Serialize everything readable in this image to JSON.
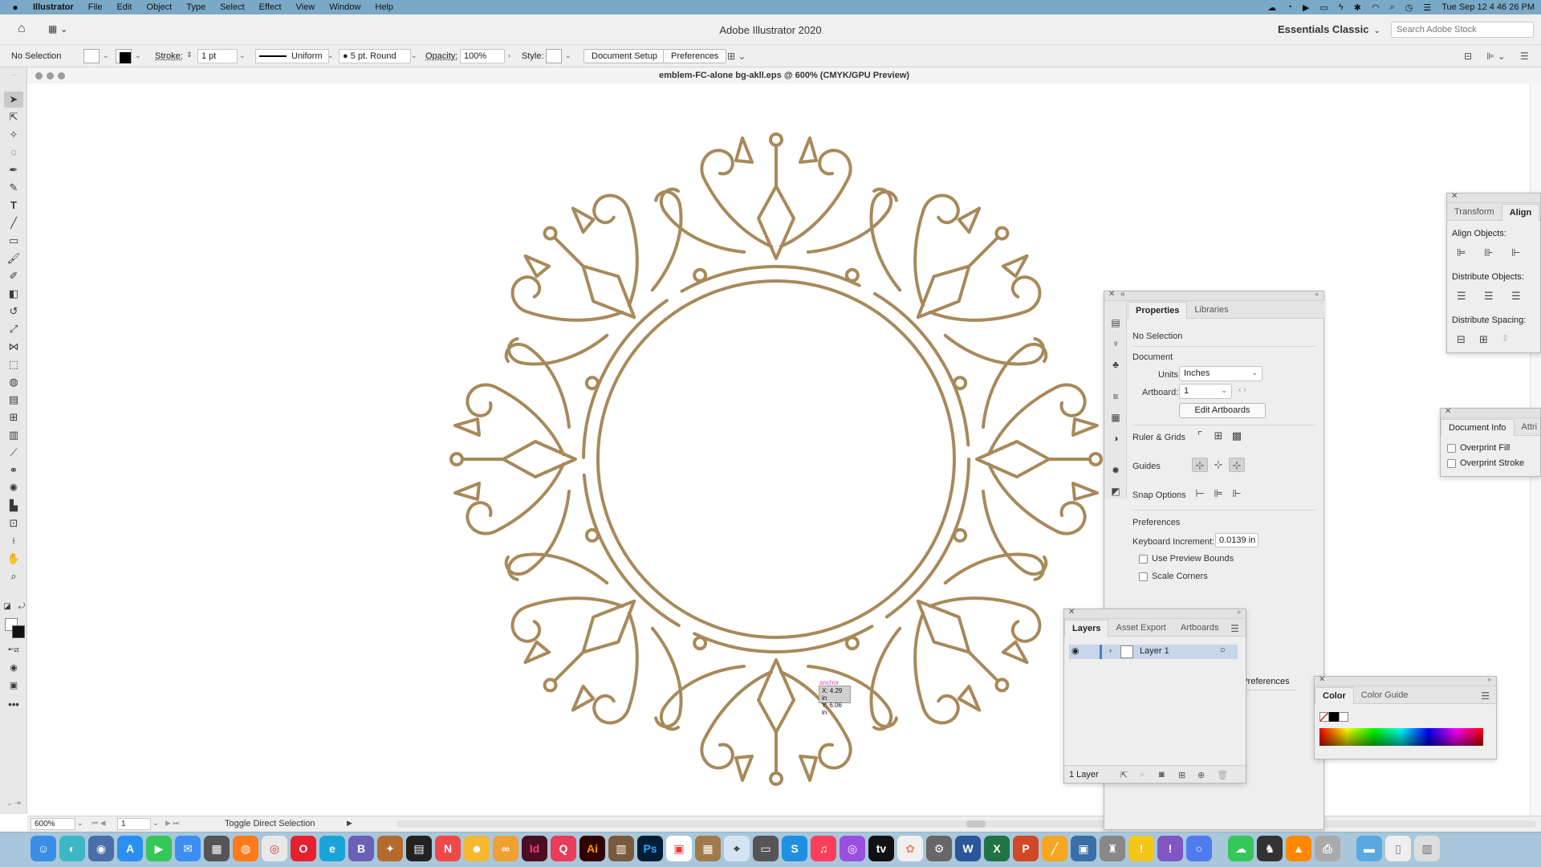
{
  "menubar": {
    "app": "Illustrator",
    "items": [
      "File",
      "Edit",
      "Object",
      "Type",
      "Select",
      "Effect",
      "View",
      "Window",
      "Help"
    ],
    "clock": "Tue Sep 12  4 46 26 PM"
  },
  "appbar": {
    "title": "Adobe Illustrator 2020",
    "workspace": "Essentials Classic",
    "search_placeholder": "Search Adobe Stock"
  },
  "controlbar": {
    "selection": "No Selection",
    "stroke_label": "Stroke:",
    "stroke_weight": "1 pt",
    "profile": "Uniform",
    "brush": "5 pt. Round",
    "opacity_label": "Opacity:",
    "opacity_value": "100%",
    "style_label": "Style:",
    "document_setup": "Document Setup",
    "preferences": "Preferences"
  },
  "document": {
    "title": "emblem-FC-alone bg-akll.eps @ 600% (CMYK/GPU Preview)",
    "ornament_color": "#a8895a"
  },
  "canvas": {
    "cursor_label": "anchor",
    "coord_x": "X: 4.29 in",
    "coord_y": "Y: 6.06 in"
  },
  "statusbar": {
    "zoom": "600%",
    "artboard": "1",
    "tool_hint": "Toggle Direct Selection"
  },
  "properties_panel": {
    "tabs": [
      "Properties",
      "Libraries"
    ],
    "selection": "No Selection",
    "document_heading": "Document",
    "units_label": "Units:",
    "units_value": "Inches",
    "artboard_label": "Artboard:",
    "artboard_value": "1",
    "edit_artboards": "Edit Artboards",
    "ruler_grids": "Ruler & Grids",
    "guides": "Guides",
    "snap_options": "Snap Options",
    "preferences_heading": "Preferences",
    "keyboard_increment_label": "Keyboard Increment:",
    "keyboard_increment_value": "0.0139 in",
    "use_preview_bounds": "Use Preview Bounds",
    "scale_corners": "Scale Corners",
    "preferences_button": "Preferences"
  },
  "align_panel": {
    "tabs": [
      "Transform",
      "Align"
    ],
    "align_objects": "Align Objects:",
    "distribute_objects": "Distribute Objects:",
    "distribute_spacing": "Distribute Spacing:"
  },
  "docinfo_panel": {
    "tabs": [
      "Document Info",
      "Attri"
    ],
    "overprint_fill": "Overprint Fill",
    "overprint_stroke": "Overprint Stroke"
  },
  "layers_panel": {
    "tabs": [
      "Layers",
      "Asset Export",
      "Artboards"
    ],
    "layer_name": "Layer 1",
    "layer_count": "1 Layer",
    "layer_color": "#4a7bd4"
  },
  "color_panel": {
    "tabs": [
      "Color",
      "Color Guide"
    ]
  },
  "dock": {
    "apps": [
      "Id",
      "Ai",
      "Ps"
    ]
  }
}
